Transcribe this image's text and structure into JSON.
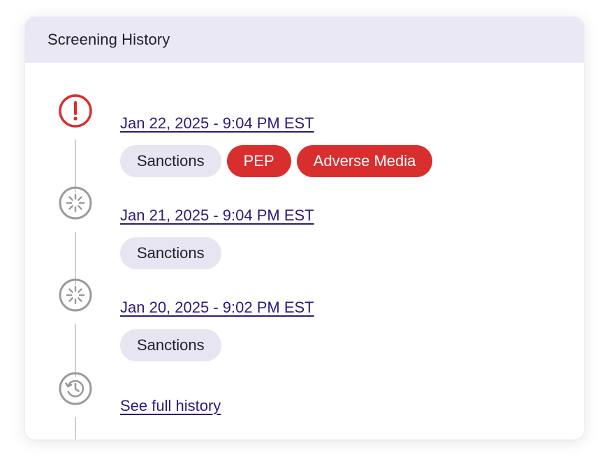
{
  "card": {
    "title": "Screening History"
  },
  "entries": [
    {
      "datetime": "Jan 22, 2025 - 9:04 PM EST",
      "status_icon": "alert-circle-icon",
      "tags": [
        {
          "label": "Sanctions",
          "variant": "neutral"
        },
        {
          "label": "PEP",
          "variant": "alert"
        },
        {
          "label": "Adverse Media",
          "variant": "alert"
        }
      ]
    },
    {
      "datetime": "Jan 21, 2025 - 9:04 PM EST",
      "status_icon": "loading-spinner-icon",
      "tags": [
        {
          "label": "Sanctions",
          "variant": "neutral"
        }
      ]
    },
    {
      "datetime": "Jan 20, 2025 - 9:02 PM EST",
      "status_icon": "loading-spinner-icon",
      "tags": [
        {
          "label": "Sanctions",
          "variant": "neutral"
        }
      ]
    }
  ],
  "footer": {
    "link_label": "See full history",
    "icon": "history-icon"
  },
  "colors": {
    "header_bg": "#e9e8f4",
    "link": "#2e1a7a",
    "alert": "#d92e2e",
    "neutral_tag_bg": "#e6e5f1",
    "icon_gray": "#9a9a9a",
    "connector": "#cfcfd6"
  }
}
